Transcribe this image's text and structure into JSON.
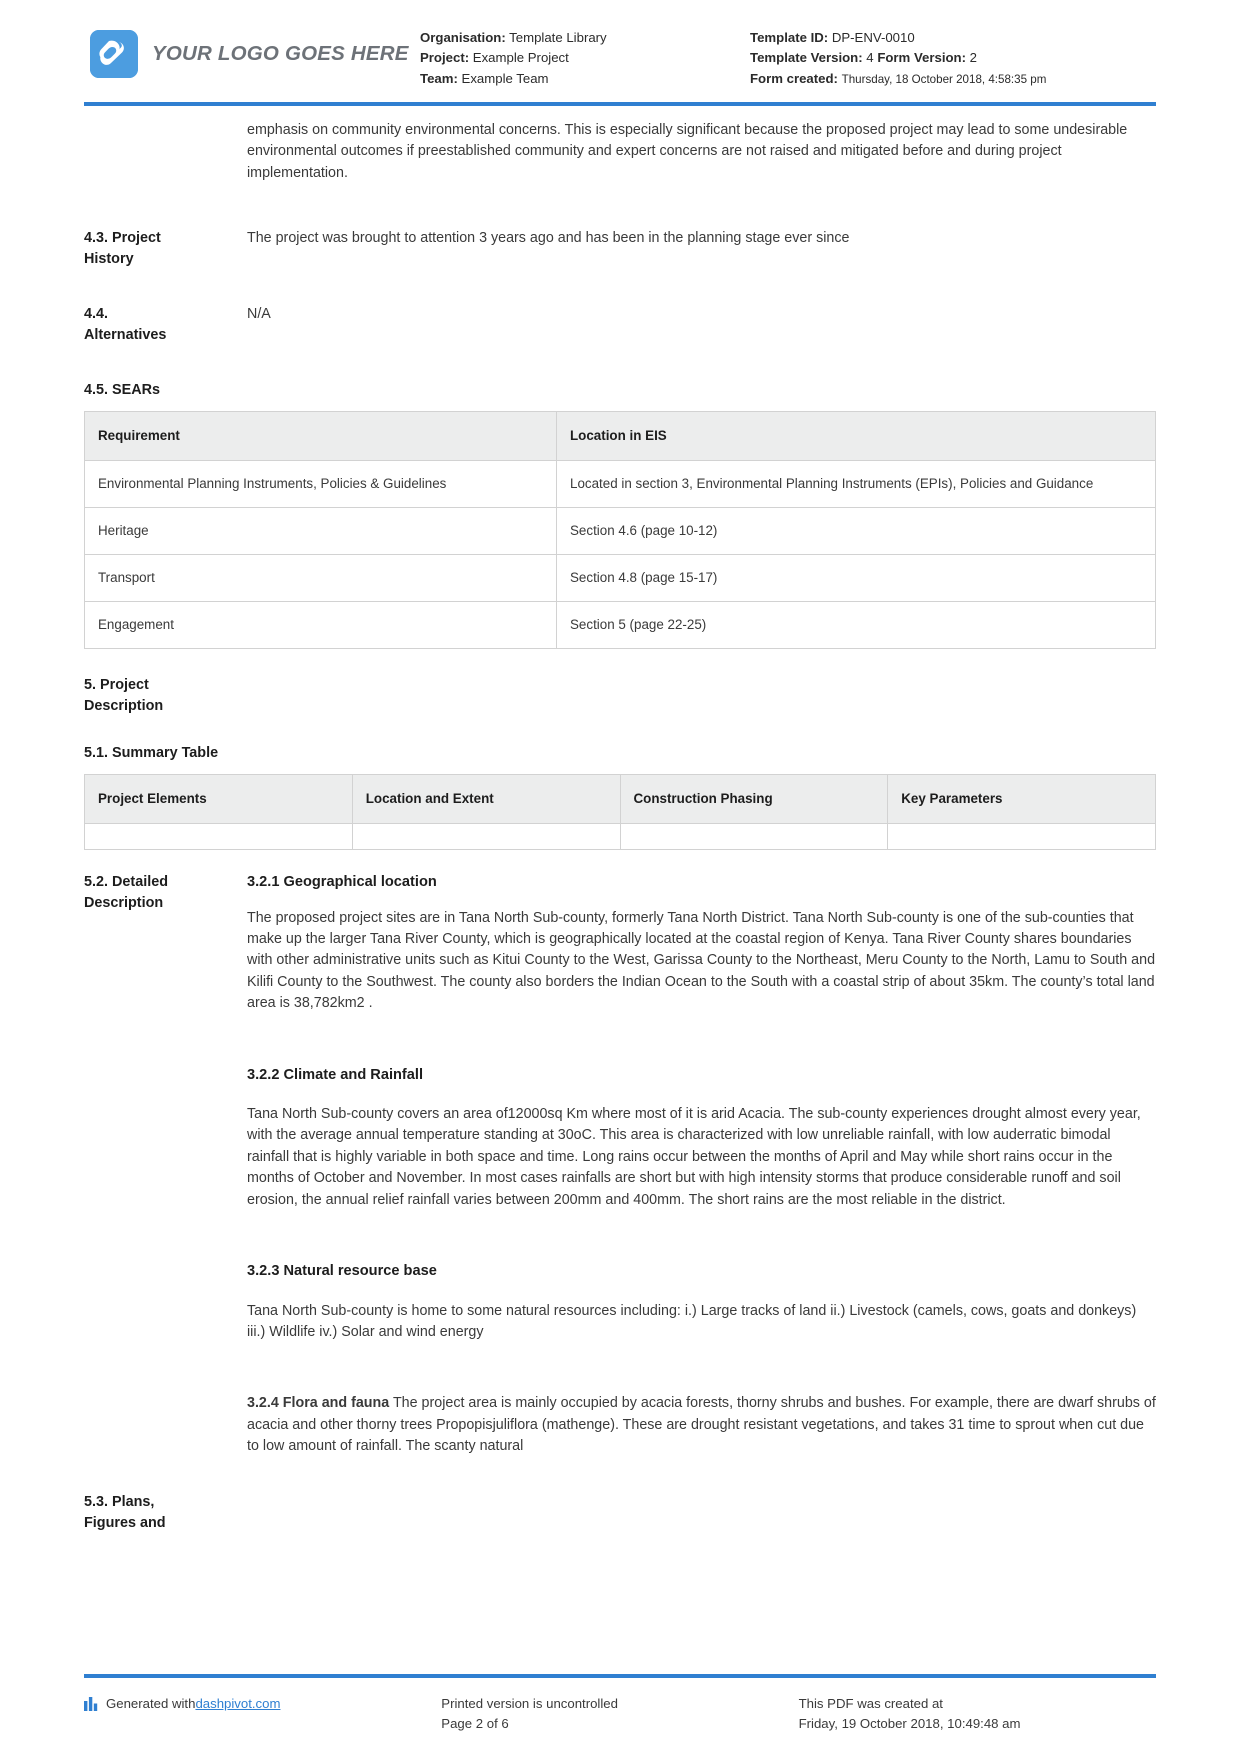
{
  "header": {
    "logo_text": "YOUR LOGO GOES HERE",
    "logo_color": "#4c9de0",
    "accent_color": "#2f7fd1",
    "left_meta": {
      "organisation_label": "Organisation:",
      "organisation_value": "Template Library",
      "project_label": "Project:",
      "project_value": "Example Project",
      "team_label": "Team:",
      "team_value": "Example Team"
    },
    "right_meta": {
      "template_id_label": "Template ID:",
      "template_id_value": "DP-ENV-0010",
      "template_version_label": "Template Version:",
      "template_version_value": "4",
      "form_version_label": "Form Version:",
      "form_version_value": "2",
      "form_created_label": "Form created:",
      "form_created_value": "Thursday, 18 October 2018, 4:58:35 pm"
    }
  },
  "body": {
    "intro_paragraph": "emphasis on community environmental concerns. This is especially significant because the proposed project may lead to some undesirable environmental outcomes if preestablished community and expert concerns are not raised and mitigated before and during project implementation.",
    "s43": {
      "label": "4.3. Project History",
      "text": "The project was brought to attention 3 years ago and has been in the planning stage ever since"
    },
    "s44": {
      "label": "4.4. Alternatives",
      "text": "N/A"
    },
    "s45": {
      "heading": "4.5. SEARs",
      "table": {
        "columns": [
          "Requirement",
          "Location in EIS"
        ],
        "rows": [
          [
            "Environmental Planning Instruments, Policies & Guidelines",
            "Located in section 3, Environmental Planning Instruments (EPIs), Policies and Guidance"
          ],
          [
            "Heritage",
            "Section 4.6 (page 10-12)"
          ],
          [
            "Transport",
            "Section 4.8 (page 15-17)"
          ],
          [
            "Engagement",
            "Section 5 (page 22-25)"
          ]
        ]
      }
    },
    "s5": {
      "heading": "5. Project Description"
    },
    "s51": {
      "heading": "5.1. Summary Table",
      "table": {
        "columns": [
          "Project Elements",
          "Location and Extent",
          "Construction Phasing",
          "Key Parameters"
        ],
        "rows": [
          [
            "",
            "",
            "",
            ""
          ]
        ]
      }
    },
    "s52": {
      "label": "5.2. Detailed Description",
      "blocks": [
        {
          "heading": "3.2.1 Geographical location",
          "text": "The proposed project sites are in Tana North Sub-county, formerly Tana North District. Tana North Sub-county is one of the sub-counties that make up the larger Tana River County, which is geographically located at the coastal region of Kenya. Tana River County shares boundaries with other administrative units such as Kitui County to the West, Garissa County to the Northeast, Meru County to the North, Lamu to South and Kilifi County to the Southwest. The county also borders the Indian Ocean to the South with a coastal strip of about 35km. The county’s total land area is 38,782km2 ."
        },
        {
          "heading": "3.2.2 Climate and Rainfall",
          "text": "Tana North Sub-county covers an area of12000sq Km where most of it is arid Acacia. The sub-county experiences drought almost every year, with the average annual temperature standing at 30oC. This area is characterized with low unreliable rainfall, with low auderratic bimodal rainfall that is highly variable in both space and time. Long rains occur between the months of April and May while short rains occur in the months of October and November. In most cases rainfalls are short but with high intensity storms that produce considerable runoff and soil erosion, the annual relief rainfall varies between 200mm and 400mm. The short rains are the most reliable in the district."
        },
        {
          "heading": "3.2.3 Natural resource base",
          "text": "Tana North Sub-county is home to some natural resources including: i.) Large tracks of land ii.) Livestock (camels, cows, goats and donkeys) iii.) Wildlife iv.) Solar and wind energy"
        },
        {
          "heading": "3.2.4 Flora and fauna",
          "inline": true,
          "text": "The project area is mainly occupied by acacia forests, thorny shrubs and bushes. For example, there are dwarf shrubs of acacia and other thorny trees Propopisjuliflora (mathenge). These are drought resistant vegetations, and takes 31 time to sprout when cut due to low amount of rainfall. The scanty natural"
        }
      ]
    },
    "s53": {
      "label": "5.3. Plans, Figures and"
    }
  },
  "footer": {
    "generated_prefix": "Generated with ",
    "generated_link": "dashpivot.com",
    "printed_line1": "Printed version is uncontrolled",
    "printed_line2": "Page 2 of 6",
    "created_line1": "This PDF was created at",
    "created_line2": "Friday, 19 October 2018, 10:49:48 am"
  }
}
